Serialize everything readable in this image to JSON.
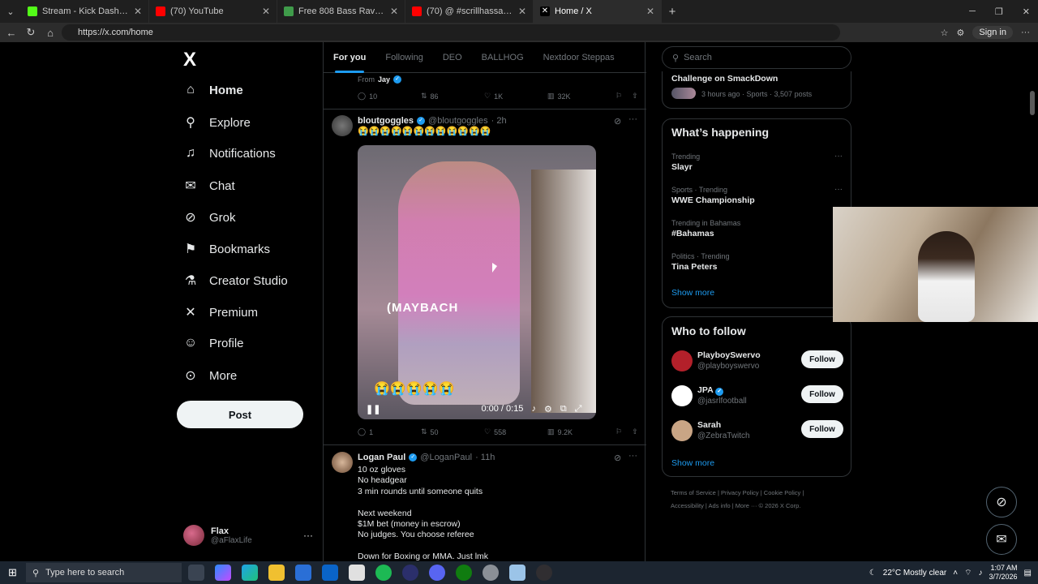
{
  "browser": {
    "tabs": [
      {
        "title": "Stream - Kick Dashboard",
        "color": "#53fc18",
        "active": false
      },
      {
        "title": "(70) YouTube",
        "color": "#ff0000",
        "active": false
      },
      {
        "title": "Free 808 Bass Rave Sound Effects",
        "color": "#3f9b4a",
        "active": false
      },
      {
        "title": "(70) @ #scrillhassan #chicago",
        "color": "#ff0000",
        "active": false
      },
      {
        "title": "Home / X",
        "color": "#000000",
        "active": true
      }
    ],
    "url": "https://x.com/home",
    "signin": "Sign in"
  },
  "sidebar": {
    "logo": "X",
    "items": [
      {
        "label": "Home",
        "icon": "home-icon",
        "glyph": "⌂"
      },
      {
        "label": "Explore",
        "icon": "search-icon",
        "glyph": "⚲"
      },
      {
        "label": "Notifications",
        "icon": "bell-icon",
        "glyph": "🔔"
      },
      {
        "label": "Chat",
        "icon": "mail-icon",
        "glyph": "✉"
      },
      {
        "label": "Grok",
        "icon": "grok-icon",
        "glyph": "⊘"
      },
      {
        "label": "Bookmarks",
        "icon": "bookmark-icon",
        "glyph": "⚑"
      },
      {
        "label": "Creator Studio",
        "icon": "flask-icon",
        "glyph": "⚗"
      },
      {
        "label": "Premium",
        "icon": "x-icon",
        "glyph": "✕"
      },
      {
        "label": "Profile",
        "icon": "person-icon",
        "glyph": "☺"
      },
      {
        "label": "More",
        "icon": "more-icon",
        "glyph": "⋯"
      }
    ],
    "post_label": "Post",
    "account": {
      "name": "Flax",
      "handle": "@aFlaxLife",
      "more": "···"
    }
  },
  "feed": {
    "tabs": [
      "For you",
      "Following",
      "DEO",
      "BALLHOG",
      "Nextdoor Steppas"
    ],
    "prev": {
      "from_label": "From",
      "from_name": "Jay",
      "replies": "10",
      "reposts": "86",
      "likes": "1K",
      "views": "32K"
    },
    "tweet1": {
      "name": "bloutgoggles",
      "handle": "@bloutgoggles",
      "time": "· 2h",
      "text": "😭😭😭😭😭😭😭😭😭😭😭😭",
      "video_caption": "(MAYBACH",
      "video_emojis": "😭😭😭😭😭",
      "video_time": "0:00 / 0:15",
      "replies": "1",
      "reposts": "50",
      "likes": "558",
      "views": "9.2K"
    },
    "tweet2": {
      "name": "Logan Paul",
      "handle": "@LoganPaul",
      "time": "· 11h",
      "text": "10 oz gloves\nNo headgear\n3 min rounds until someone quits\n\nNext weekend\n$1M bet (money in escrow)\nNo judges. You choose referee\n\nDown for Boxing or MMA. Just lmk"
    }
  },
  "right": {
    "search_placeholder": "Search",
    "top_story": {
      "title": "Challenge on SmackDown",
      "meta": "3 hours ago · Sports · 3,507 posts"
    },
    "happening_title": "What’s happening",
    "trends": [
      {
        "meta": "Trending",
        "name": "Slayr"
      },
      {
        "meta": "Sports · Trending",
        "name": "WWE Championship"
      },
      {
        "meta": "Trending in Bahamas",
        "name": "#Bahamas"
      },
      {
        "meta": "Politics · Trending",
        "name": "Tina Peters"
      }
    ],
    "show_more": "Show more",
    "follow_title": "Who to follow",
    "follow": [
      {
        "name": "PlayboySwervo",
        "handle": "@playboyswervo",
        "btn": "Follow",
        "color": "#b3202a"
      },
      {
        "name": "JPA",
        "handle": "@jasrlfootball",
        "btn": "Follow",
        "color": "#ffffff"
      },
      {
        "name": "Sarah",
        "handle": "@ZebraTwitch",
        "btn": "Follow",
        "color": "#c9a585"
      }
    ],
    "footer": [
      "Terms of Service",
      "Privacy Policy",
      "Cookie Policy",
      "Accessibility",
      "Ads info",
      "More ···",
      "© 2026 X Corp."
    ]
  },
  "taskbar": {
    "search_placeholder": "Type here to search",
    "weather": "22°C  Mostly clear",
    "time": "1:07 AM",
    "date": "3/7/2026"
  },
  "colors": {
    "accent": "#1d9bf0",
    "background": "#000000",
    "border": "#2f3336"
  }
}
